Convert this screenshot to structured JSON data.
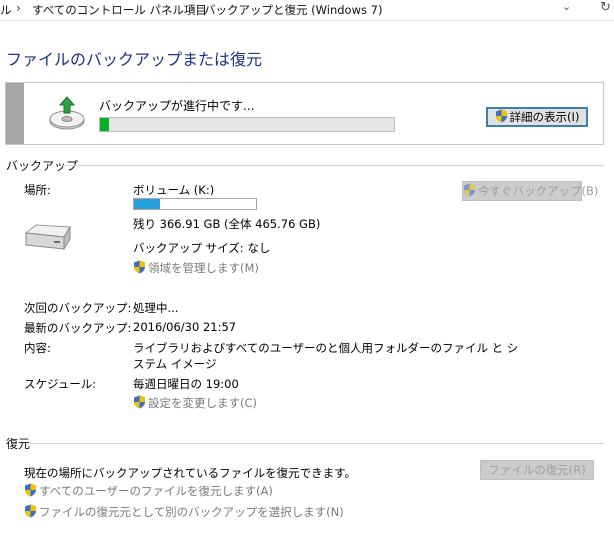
{
  "breadcrumb": {
    "items": [
      "ル",
      "すべてのコントロール パネル項目",
      "バックアップと復元 (Windows 7)"
    ],
    "separator": "›"
  },
  "page_title": "ファイルのバックアップまたは復元",
  "progress": {
    "label": "バックアップが進行中です...",
    "fraction": 0.03,
    "details_button": "詳細の表示(I)"
  },
  "backup": {
    "section_title": "バックアップ",
    "location_label": "場所:",
    "location_value": "ボリューム (K:)",
    "usage_fraction": 0.21,
    "remaining": "残り 366.91 GB (全体 465.76 GB)",
    "backup_size": "バックアップ サイズ: なし",
    "manage_space_link": "領域を管理します(M)",
    "backup_now_button": "今すぐバックアップ(B)",
    "next_backup_label": "次回のバックアップ:",
    "next_backup_value": "処理中...",
    "last_backup_label": "最新のバックアップ:",
    "last_backup_value": "2016/06/30 21:57",
    "contents_label": "内容:",
    "contents_value_line1": "ライブラリおよびすべてのユーザーのと個人用フォルダーのファイル と シ",
    "contents_value_line2": "ステム イメージ",
    "schedule_label": "スケジュール:",
    "schedule_value": "毎週日曜日の 19:00",
    "change_settings_link": "設定を変更します(C)"
  },
  "restore": {
    "section_title": "復元",
    "description": "現在の場所にバックアップされているファイルを復元できます。",
    "restore_button": "ファイルの復元(R)",
    "restore_all_link": "すべてのユーザーのファイルを復元します(A)",
    "select_other_link": "ファイルの復元元として別のバックアップを選択します(N)"
  },
  "colors": {
    "title": "#1e3287",
    "progress_green": "#06b025",
    "usage_blue": "#26a0da",
    "disabled_text": "#a0a0a0"
  }
}
